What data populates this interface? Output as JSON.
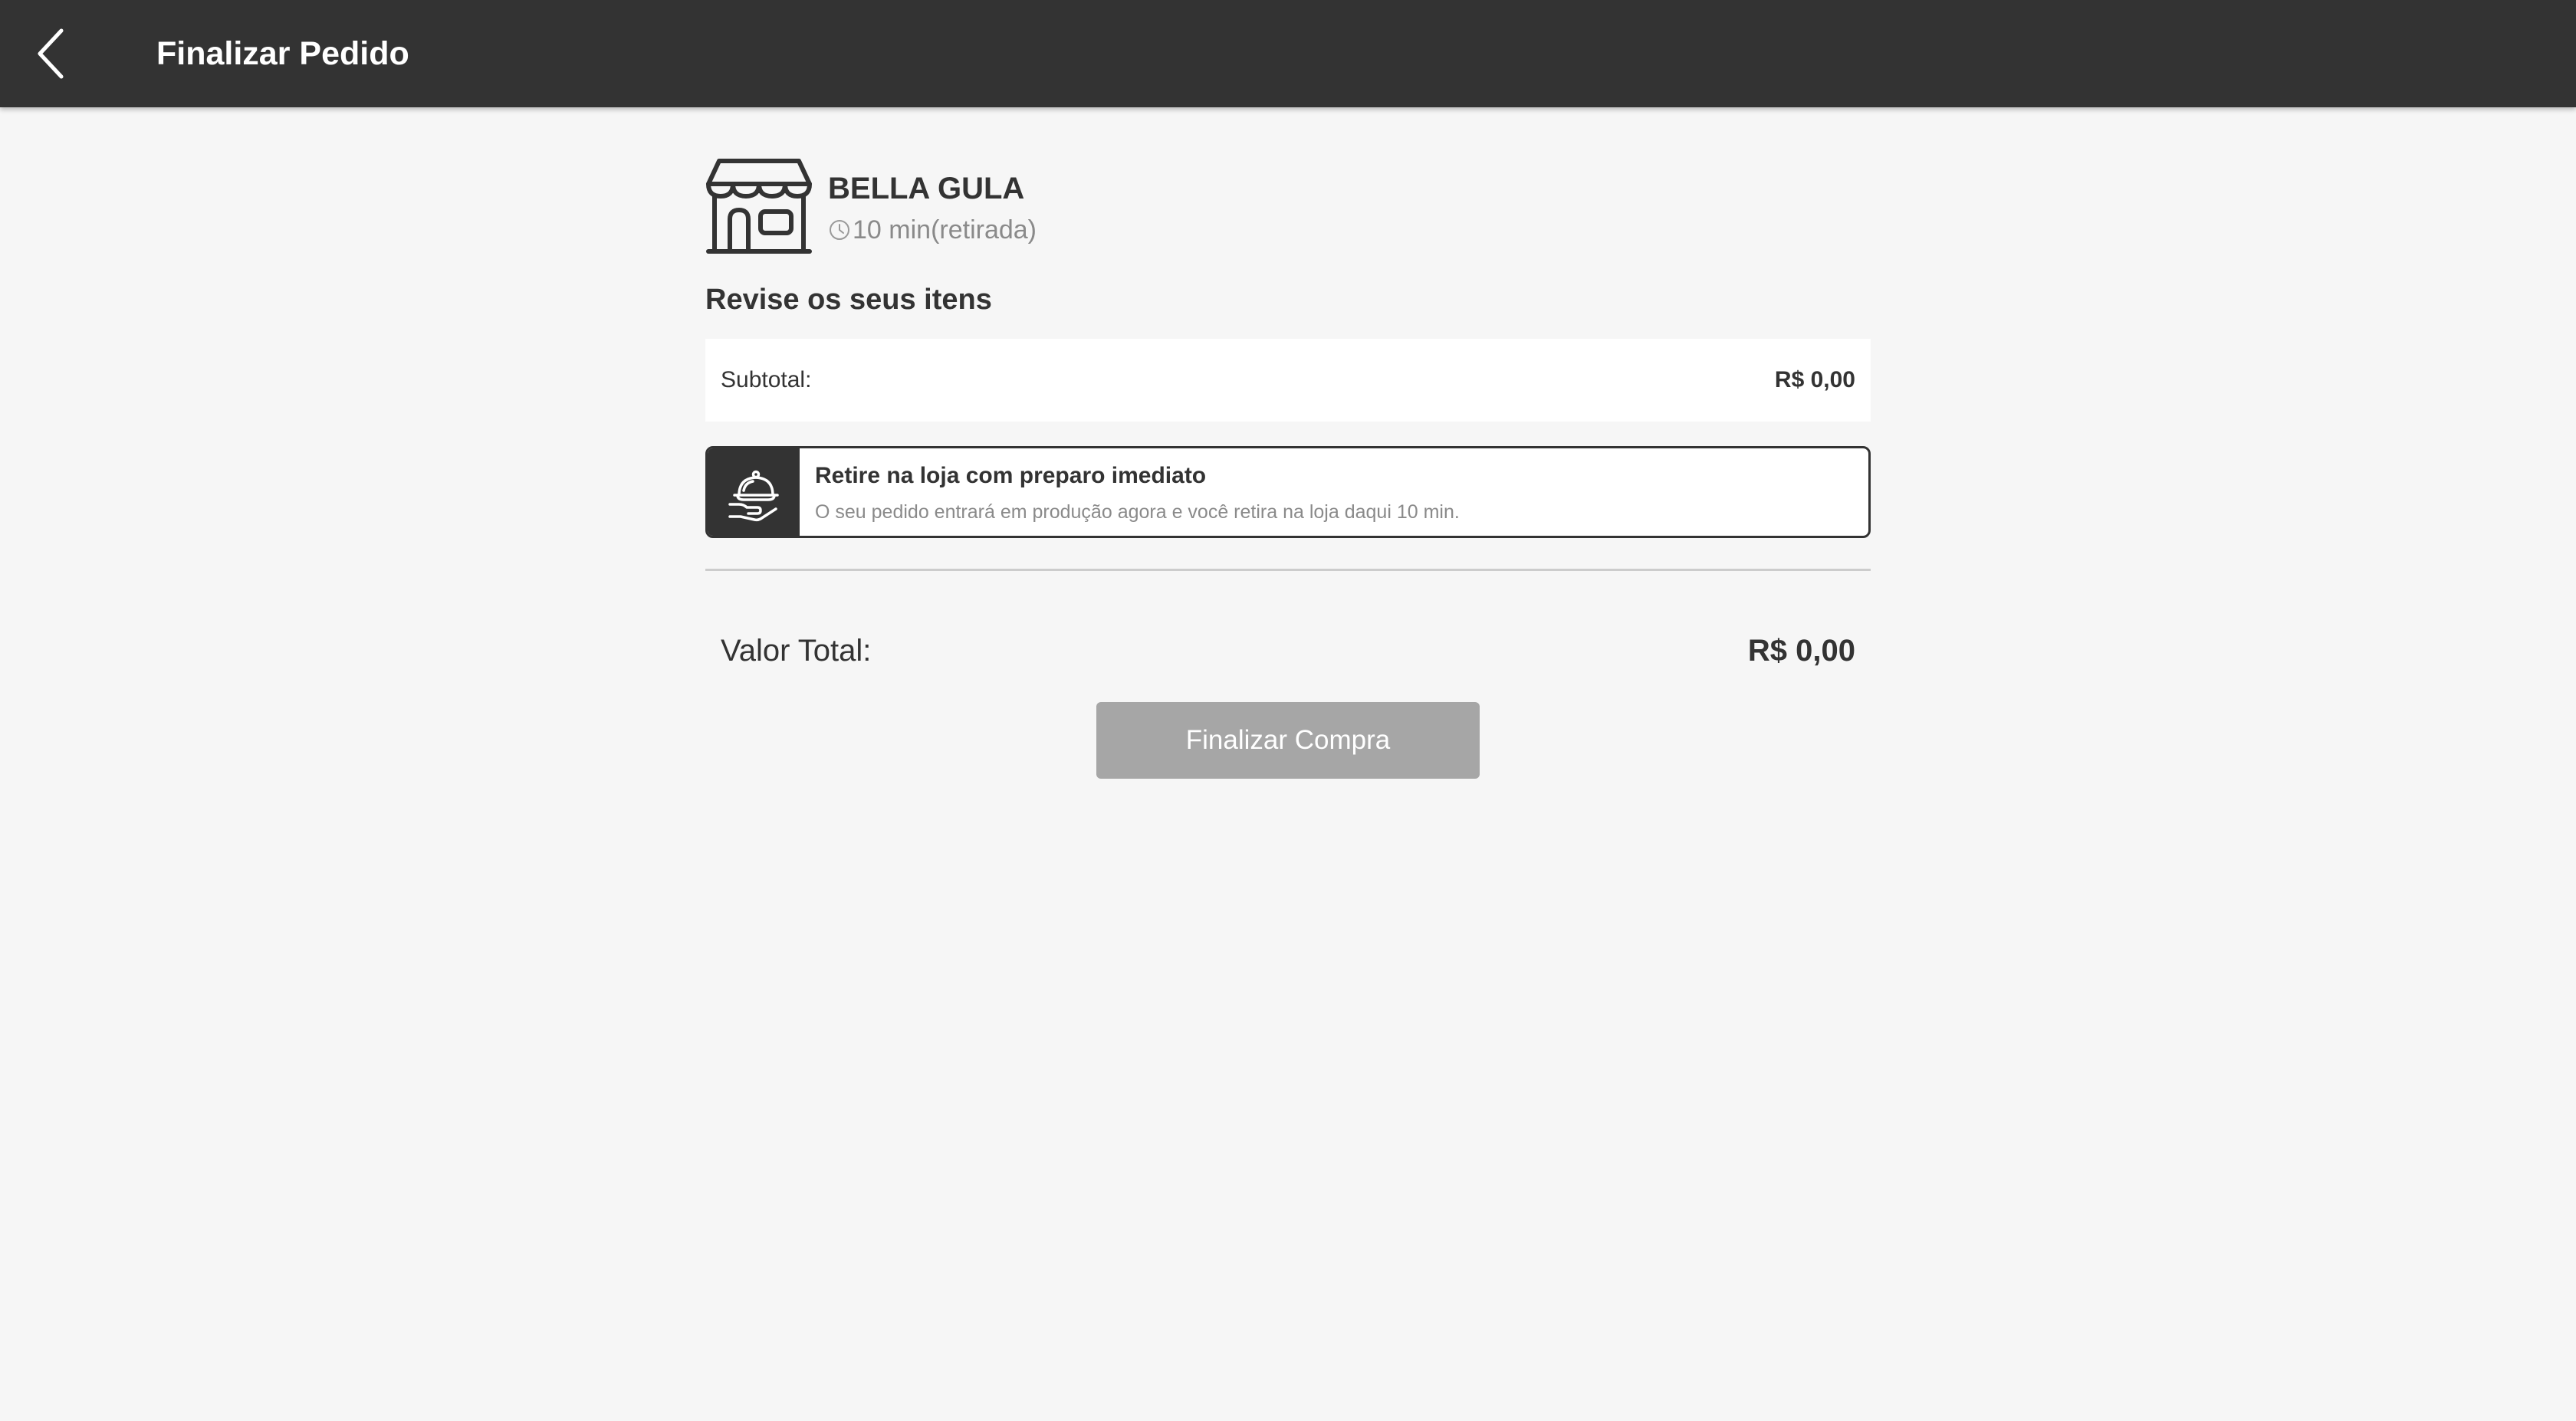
{
  "header": {
    "title": "Finalizar Pedido",
    "back_icon": "chevron-left-icon"
  },
  "store": {
    "name": "BELLA GULA",
    "icon": "storefront-icon",
    "time_icon": "clock-icon",
    "prep_time": "10 min",
    "mode": "(retirada)"
  },
  "review": {
    "title": "Revise os seus itens"
  },
  "subtotal": {
    "label": "Subtotal:",
    "value": "R$ 0,00"
  },
  "pickup_option": {
    "icon": "serving-cloche-icon",
    "title": "Retire na loja com preparo imediato",
    "description": "O seu pedido entrará em produção agora e você retira na loja daqui 10 min."
  },
  "total": {
    "label": "Valor Total:",
    "value": "R$ 0,00"
  },
  "actions": {
    "finalize_label": "Finalizar Compra"
  },
  "colors": {
    "topbar": "#333333",
    "background": "#f6f6f6",
    "button_disabled": "#a6a6a6",
    "muted_text": "#8a8a8a"
  }
}
